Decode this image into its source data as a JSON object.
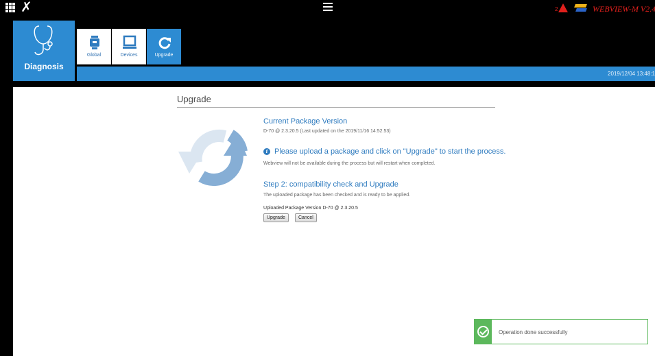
{
  "topbar": {
    "apps_icon": "grid-apps-icon",
    "tools_icon": "tools-icon",
    "menu_icon": "hamburger-menu-icon",
    "alert_icon": "warning-triangle-icon",
    "alert_sub": "2",
    "flag_icon": "flag-icon",
    "brand": "WEBVIEW-M V2.4",
    "brand_color": "#e0201c"
  },
  "diagnosis": {
    "label": "Diagnosis",
    "icon": "stethoscope-icon"
  },
  "tiles": [
    {
      "label": "Global",
      "icon": "pump-icon"
    },
    {
      "label": "Devices",
      "icon": "monitor-icon"
    },
    {
      "label": "Upgrade",
      "icon": "refresh-icon"
    }
  ],
  "statusbar": {
    "datetime": "2019/12/04 13:48:1",
    "accent": "#2d8bd2"
  },
  "main": {
    "title": "Upgrade",
    "current_package": {
      "heading": "Current Package Version",
      "detail": "D-70 @ 2.3.20.5 (Last updated on the 2019/11/16 14:52:53)"
    },
    "info": {
      "message": "Please upload a package and click on \"Upgrade\" to start the process.",
      "note": "Webview will not be available during the process but will restart when completed."
    },
    "step2": {
      "heading": "Step 2: compatibility check and Upgrade",
      "detail": "The uploaded package has been checked and is ready to be applied.",
      "uploaded_version": "Uploaded Package Version D-70 @ 2.3.20.5"
    },
    "buttons": {
      "upgrade": "Upgrade",
      "cancel": "Cancel"
    }
  },
  "toast": {
    "message": "Operation done successfully",
    "icon": "check-circle-icon",
    "color": "#5cb85c"
  }
}
